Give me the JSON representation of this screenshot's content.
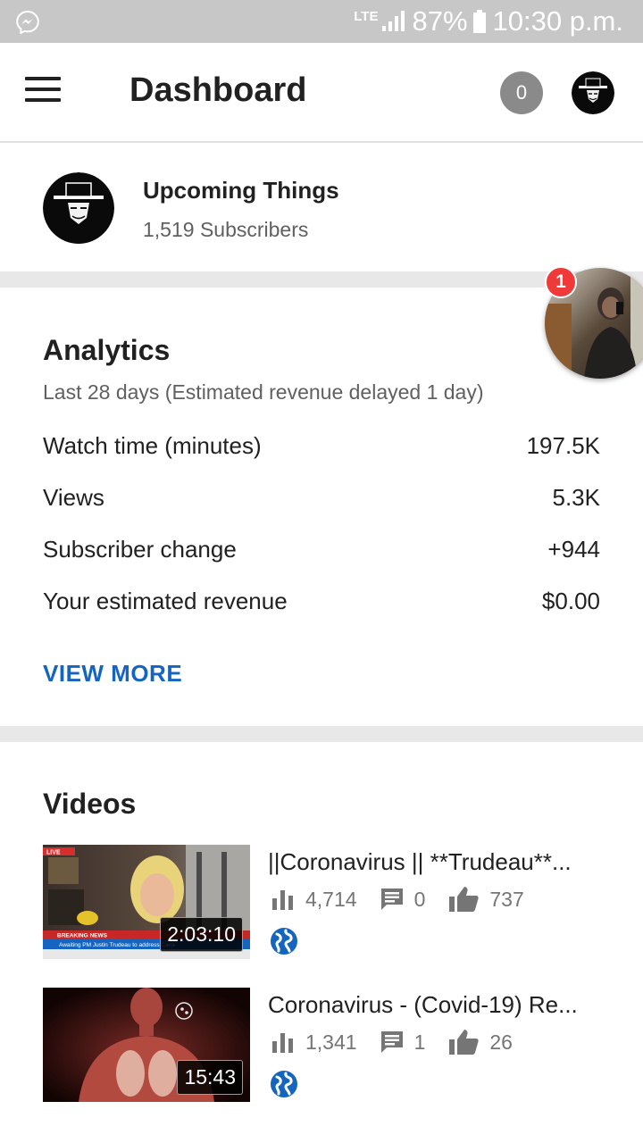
{
  "status_bar": {
    "network": "LTE",
    "battery": "87%",
    "time": "10:30 p.m."
  },
  "app_bar": {
    "title": "Dashboard",
    "notification_count": "0"
  },
  "channel": {
    "name": "Upcoming Things",
    "subscribers": "1,519 Subscribers"
  },
  "chat_head": {
    "badge": "1"
  },
  "analytics": {
    "title": "Analytics",
    "subtitle": "Last 28 days (Estimated revenue delayed 1 day)",
    "metrics": [
      {
        "label": "Watch time (minutes)",
        "value": "197.5K"
      },
      {
        "label": "Views",
        "value": "5.3K"
      },
      {
        "label": "Subscriber change",
        "value": "+944"
      },
      {
        "label": "Your estimated revenue",
        "value": "$0.00"
      }
    ],
    "view_more": "VIEW MORE"
  },
  "videos": {
    "title": "Videos",
    "items": [
      {
        "title": "||Coronavirus || **Trudeau**...",
        "duration": "2:03:10",
        "views": "4,714",
        "comments": "0",
        "likes": "737",
        "thumb_text": {
          "live": "LIVE",
          "breaking": "BREAKING NEWS",
          "ticker": "Awaiting PM Justin Trudeau to address Cana"
        }
      },
      {
        "title": "Coronavirus - (Covid-19) Re...",
        "duration": "15:43",
        "views": "1,341",
        "comments": "1",
        "likes": "26"
      }
    ]
  },
  "icons": {
    "messenger": "messenger-icon",
    "signal": "signal-icon",
    "battery": "battery-icon",
    "menu": "menu-icon",
    "views": "bar-chart-icon",
    "comments": "comment-icon",
    "likes": "thumbs-up-icon",
    "visibility": "globe-icon"
  },
  "colors": {
    "accent": "#1565c0",
    "badge_red": "#f03a3a",
    "status_bar": "#c7c7c7",
    "divider": "#e8e8e8"
  }
}
